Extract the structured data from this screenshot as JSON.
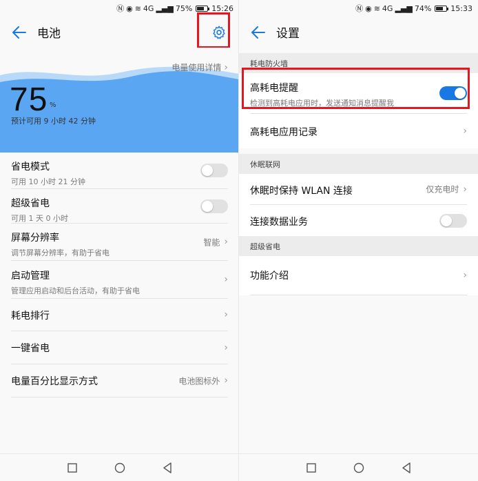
{
  "left": {
    "status": {
      "signal": "4G",
      "battery_pct": "75%",
      "battery_level": 0.75,
      "time": "15:26"
    },
    "title": "电池",
    "hero": {
      "usage_link": "电量使用详情",
      "percent": "75",
      "percent_sign": "%",
      "remaining": "预计可用 9 小时 42 分钟"
    },
    "rows": [
      {
        "title": "省电模式",
        "sub": "可用 10 小时 21 分钟",
        "control": "toggle",
        "on": false
      },
      {
        "title": "超级省电",
        "sub": "可用 1 天 0 小时",
        "control": "toggle",
        "on": false
      },
      {
        "title": "屏幕分辨率",
        "sub": "调节屏幕分辨率，有助于省电",
        "value": "智能",
        "control": "chevron"
      },
      {
        "title": "启动管理",
        "sub": "管理应用启动和后台活动，有助于省电",
        "control": "chevron"
      },
      {
        "title": "耗电排行",
        "control": "chevron"
      },
      {
        "title": "一键省电",
        "control": "chevron"
      },
      {
        "title": "电量百分比显示方式",
        "value": "电池图标外",
        "control": "chevron"
      }
    ]
  },
  "right": {
    "status": {
      "signal": "4G",
      "battery_pct": "74%",
      "battery_level": 0.74,
      "time": "15:33"
    },
    "title": "设置",
    "sections": [
      {
        "header": "耗电防火墙",
        "rows": [
          {
            "title": "高耗电提醒",
            "sub": "检测到高耗电应用时，发送通知消息提醒我",
            "control": "toggle",
            "on": true
          },
          {
            "title": "高耗电应用记录",
            "control": "chevron"
          }
        ]
      },
      {
        "header": "休眠联网",
        "rows": [
          {
            "title": "休眠时保持 WLAN 连接",
            "value": "仅充电时",
            "control": "chevron"
          },
          {
            "title": "连接数据业务",
            "control": "toggle",
            "on": false
          }
        ]
      },
      {
        "header": "超级省电",
        "rows": [
          {
            "title": "功能介绍",
            "control": "chevron"
          }
        ]
      }
    ]
  },
  "icons": {
    "back": "back-arrow-icon",
    "settings": "gear-icon",
    "chevron": "chevron-right-icon"
  },
  "colors": {
    "accent": "#1a78e5",
    "highlight_box": "#e8141e",
    "wave": "#5aa6f2"
  }
}
